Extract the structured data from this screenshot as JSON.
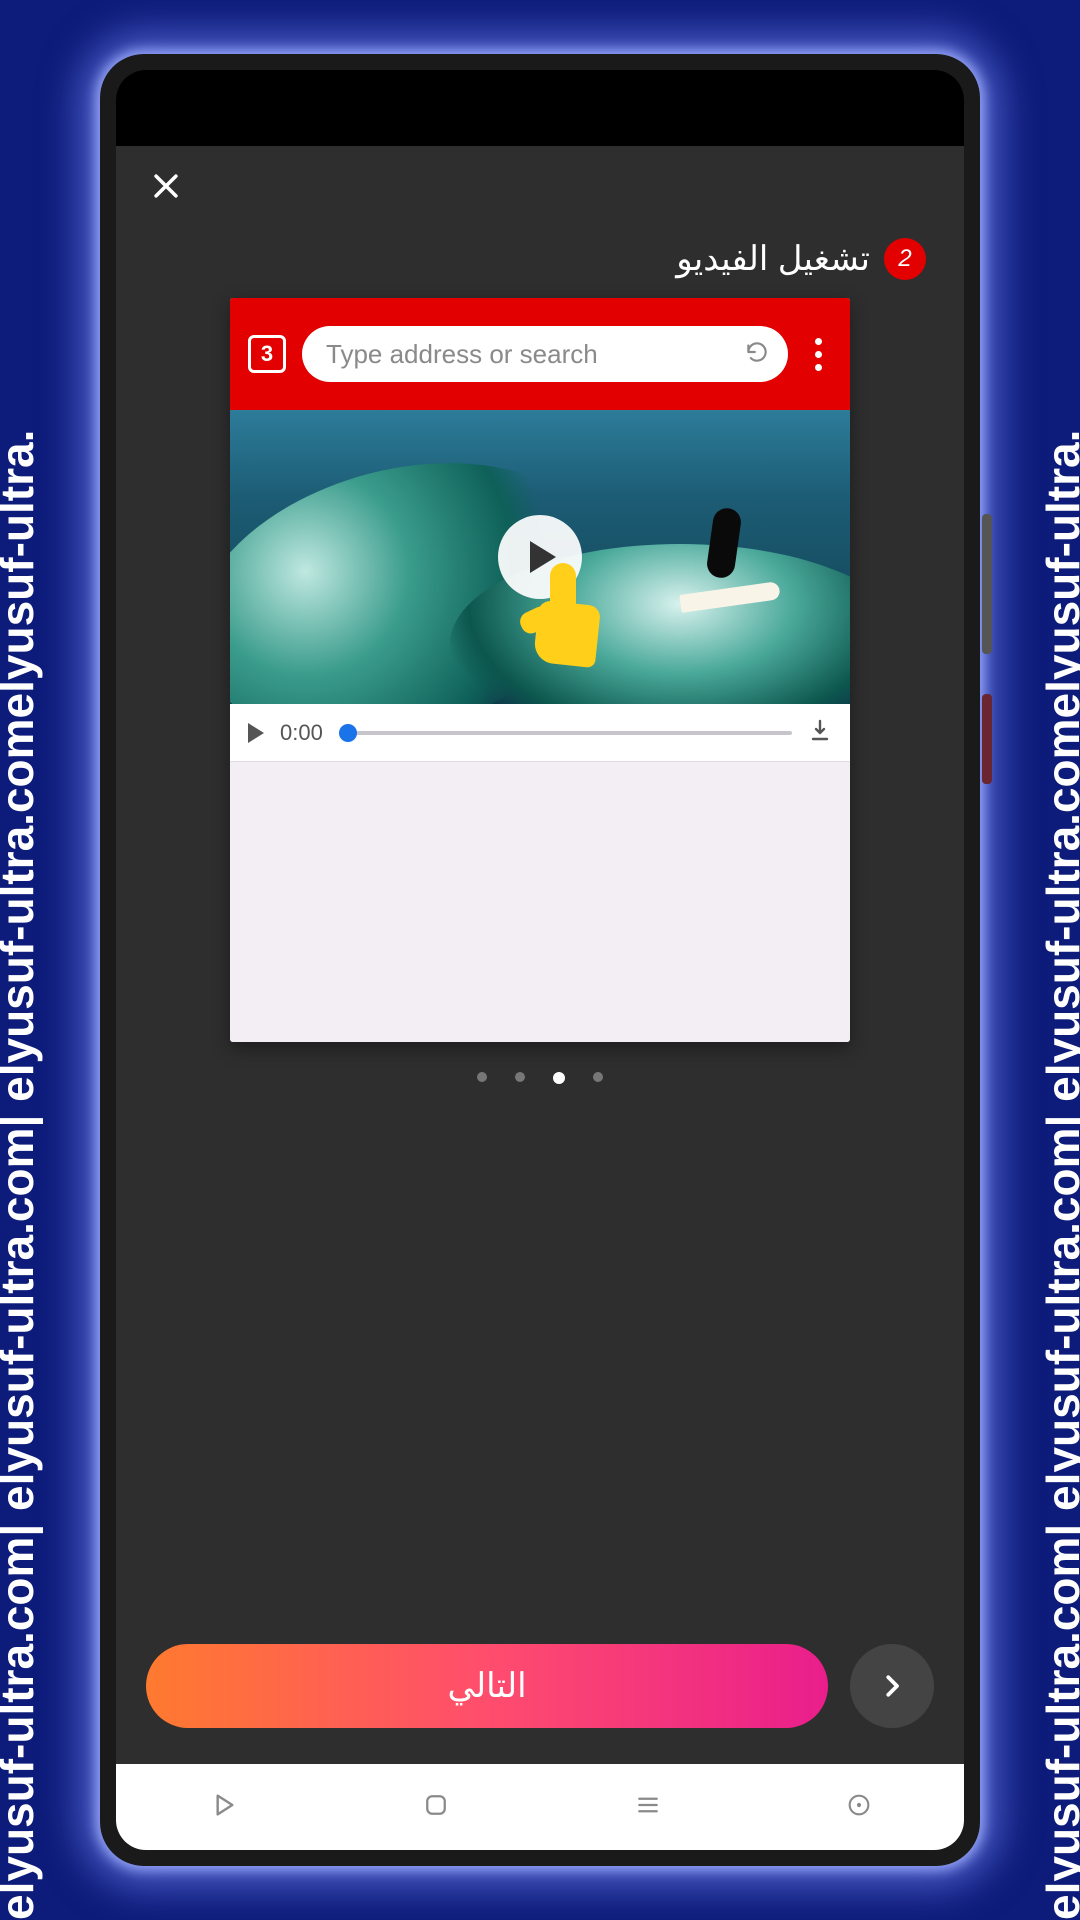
{
  "watermark_text": "elyusuf-ultra.com| elyusuf-ultra.com| elyusuf-ultra.comelyusuf-ultra.",
  "step": {
    "number": "2",
    "title": "تشغيل الفيديو"
  },
  "browser": {
    "tab_count": "3",
    "search_placeholder": "Type address or search"
  },
  "player": {
    "time": "0:00"
  },
  "pager": {
    "total": 4,
    "active_index": 2
  },
  "actions": {
    "next_label": "التالي"
  }
}
